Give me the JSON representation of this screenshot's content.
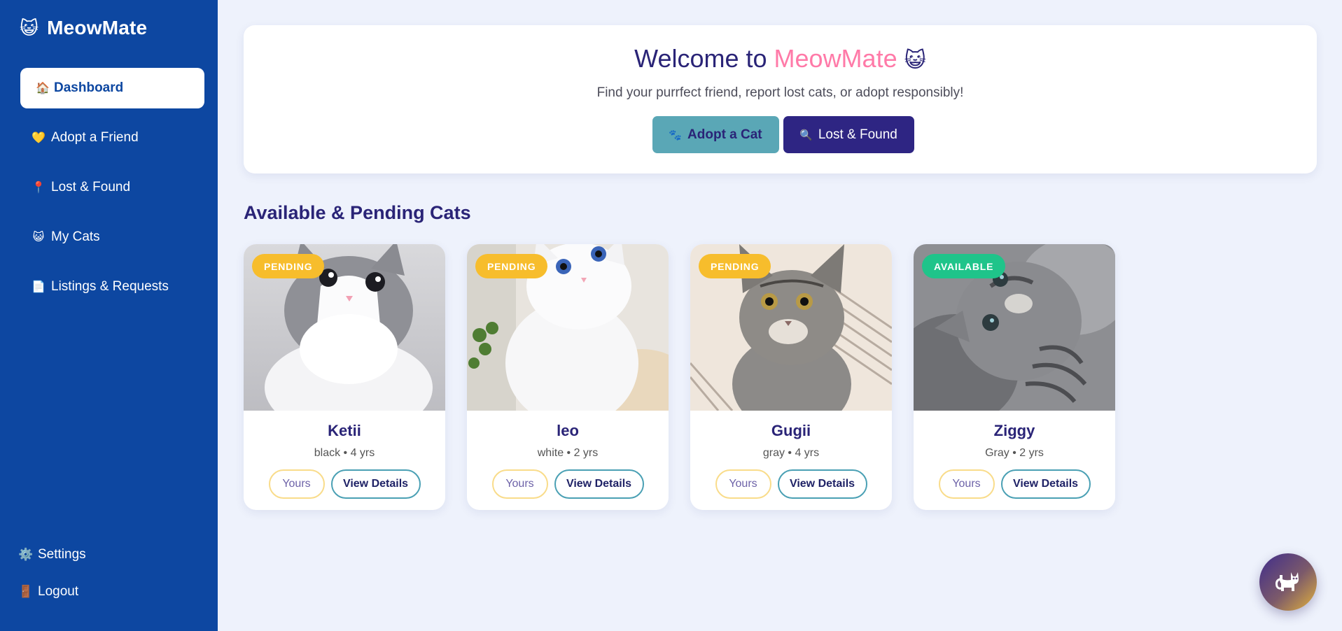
{
  "brand": {
    "emoji": "😺",
    "name": "MeowMate"
  },
  "sidebar": {
    "items": [
      {
        "icon": "🏠",
        "label": "Dashboard",
        "active": true
      },
      {
        "icon": "💛",
        "label": "Adopt a Friend"
      },
      {
        "icon": "📍",
        "label": "Lost & Found"
      },
      {
        "icon": "😺",
        "label": "My Cats"
      },
      {
        "icon": "📄",
        "label": "Listings & Requests"
      }
    ],
    "bottom": [
      {
        "icon": "⚙️",
        "label": "Settings"
      },
      {
        "icon": "🚪",
        "label": "Logout"
      }
    ]
  },
  "hero": {
    "title_prefix": "Welcome to",
    "title_brand": "MeowMate",
    "title_emoji": "😺",
    "subtitle": "Find your purrfect friend, report lost cats, or adopt responsibly!",
    "adopt_icon": "🐾",
    "adopt_label": "Adopt a Cat",
    "lost_icon": "🔍",
    "lost_label": "Lost & Found"
  },
  "section": {
    "title": "Available & Pending Cats"
  },
  "cards": [
    {
      "status": "PENDING",
      "name": "Ketii",
      "meta": "black • 4 yrs",
      "yours": "Yours",
      "view": "View Details"
    },
    {
      "status": "PENDING",
      "name": "leo",
      "meta": "white • 2 yrs",
      "yours": "Yours",
      "view": "View Details"
    },
    {
      "status": "PENDING",
      "name": "Gugii",
      "meta": "gray • 4 yrs",
      "yours": "Yours",
      "view": "View Details"
    },
    {
      "status": "AVAILABLE",
      "name": "Ziggy",
      "meta": "Gray • 2 yrs",
      "yours": "Yours",
      "view": "View Details"
    }
  ],
  "colors": {
    "sidebar": "#0d47a1",
    "pending": "#f7bd2c",
    "available": "#1fc48a",
    "brand_pink": "#ff7aa8",
    "heading": "#2a2477"
  },
  "fab": {
    "icon": "cat-silhouette-icon"
  }
}
